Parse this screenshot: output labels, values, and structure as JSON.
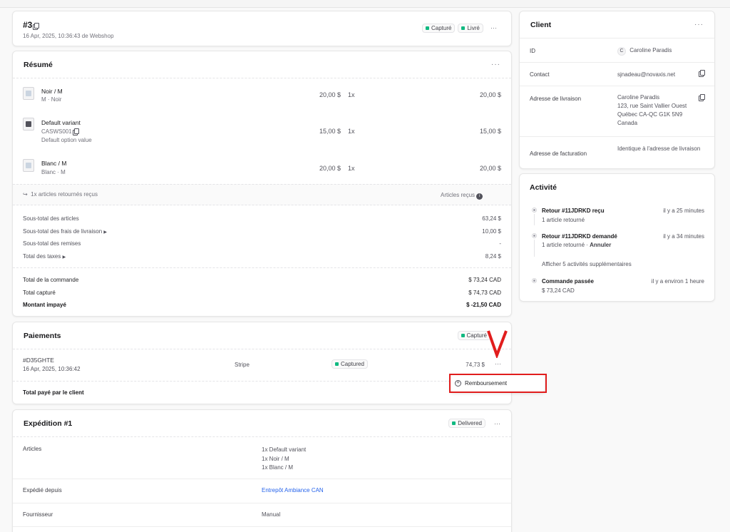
{
  "order": {
    "title": "#3",
    "subtitle": "16 Apr, 2025, 10:36:43 de Webshop",
    "badges": [
      "Capturé",
      "Livré"
    ]
  },
  "summary": {
    "title": "Résumé",
    "items": [
      {
        "name": "Noir / M",
        "sub": "M · Noir",
        "price": "20,00 $",
        "qty": "1x",
        "total": "20,00 $"
      },
      {
        "name": "Default variant",
        "sku": "CASWS001",
        "sub": "Default option value",
        "price": "15,00 $",
        "qty": "1x",
        "total": "15,00 $"
      },
      {
        "name": "Blanc / M",
        "sub": "Blanc · M",
        "price": "20,00 $",
        "qty": "1x",
        "total": "20,00 $"
      }
    ],
    "returned_text": "1x articles retournés reçus",
    "returned_status": "Articles reçus",
    "totals": [
      {
        "label": "Sous-total des articles",
        "value": "63,24 $"
      },
      {
        "label": "Sous-total des frais de livraison",
        "value": "10,00 $"
      },
      {
        "label": "Sous-total des remises",
        "value": "-"
      },
      {
        "label": "Total des taxes",
        "value": "8,24 $"
      }
    ],
    "grand": [
      {
        "label": "Total de la commande",
        "value": "$ 73,24 CAD"
      },
      {
        "label": "Total capturé",
        "value": "$ 74,73 CAD"
      },
      {
        "label": "Montant impayé",
        "value": "$ -21,50 CAD"
      }
    ]
  },
  "payments": {
    "title": "Paiements",
    "badge": "Capturé",
    "id": "#D35GHTE",
    "date": "16 Apr, 2025, 10:36:42",
    "provider": "Stripe",
    "status": "Captured",
    "amount": "74,73 $",
    "total_label": "Total payé par le client"
  },
  "menu": {
    "refund": "Remboursement"
  },
  "shipment": {
    "title": "Expédition #1",
    "badge": "Delivered",
    "rows": [
      {
        "label": "Articles",
        "lines": [
          "1x Default variant",
          "1x Noir / M",
          "1x Blanc / M"
        ]
      },
      {
        "label": "Expédié depuis",
        "value": "Entrepôt Ambiance CAN"
      },
      {
        "label": "Fournisseur",
        "value": "Manual"
      }
    ]
  },
  "client": {
    "title": "Client",
    "id_label": "ID",
    "avatar": "C",
    "name": "Caroline Paradis",
    "contact_label": "Contact",
    "email": "sjnadeau@novaxis.net",
    "ship_label": "Adresse de livraison",
    "ship_lines": [
      "Caroline Paradis",
      "123, rue Saint Vallier Ouest",
      "Québec CA-QC G1K 5N9",
      "Canada"
    ],
    "bill_label": "Adresse de facturation",
    "bill_value": "Identique à l'adresse de livraison"
  },
  "activity": {
    "title": "Activité",
    "events": [
      {
        "title": "Retour #11JDRKD reçu",
        "time": "il y a 25 minutes",
        "detail": "1 article retourné"
      },
      {
        "title": "Retour #11JDRKD demandé",
        "time": "il y a 34 minutes",
        "detail": "1 article retourné",
        "action": "Annuler"
      },
      {
        "title": "Commande passée",
        "time": "il y a environ 1 heure",
        "detail": "$ 73,24 CAD"
      }
    ],
    "more": "Afficher 5 activités supplémentaires"
  },
  "colors": {
    "accent": "#2563eb",
    "success": "#10b981",
    "annotation": "#e11d1d"
  }
}
